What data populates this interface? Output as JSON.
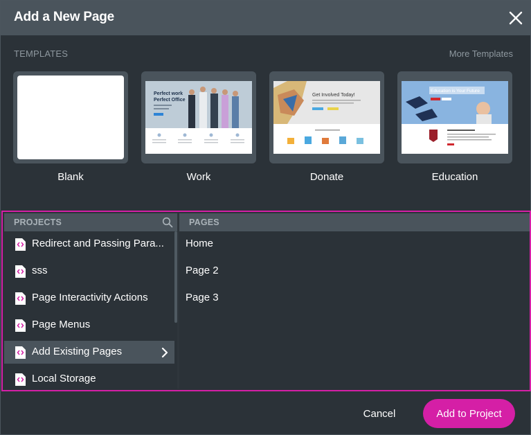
{
  "dialog": {
    "title": "Add a New Page",
    "close_icon": "close-icon"
  },
  "templates": {
    "header": "TEMPLATES",
    "more_link": "More Templates",
    "items": [
      {
        "label": "Blank"
      },
      {
        "label": "Work",
        "thumb_text": "Perfect work Perfect Office"
      },
      {
        "label": "Donate",
        "thumb_text": "Get Involved Today!"
      },
      {
        "label": "Education",
        "thumb_text": "Education is Your Future"
      }
    ]
  },
  "projects": {
    "header": "PROJECTS",
    "search_icon": "search-icon",
    "items": [
      {
        "label": "Redirect and Passing Para..."
      },
      {
        "label": "sss"
      },
      {
        "label": "Page Interactivity Actions"
      },
      {
        "label": "Page Menus"
      },
      {
        "label": "Add Existing Pages",
        "selected": true
      },
      {
        "label": "Local Storage"
      }
    ]
  },
  "pages": {
    "header": "PAGES",
    "items": [
      {
        "label": "Home"
      },
      {
        "label": "Page 2"
      },
      {
        "label": "Page 3"
      }
    ]
  },
  "footer": {
    "cancel_label": "Cancel",
    "add_label": "Add to Project"
  },
  "colors": {
    "accent": "#d51fa6",
    "background": "#2b3238",
    "panel": "#4a545c"
  }
}
